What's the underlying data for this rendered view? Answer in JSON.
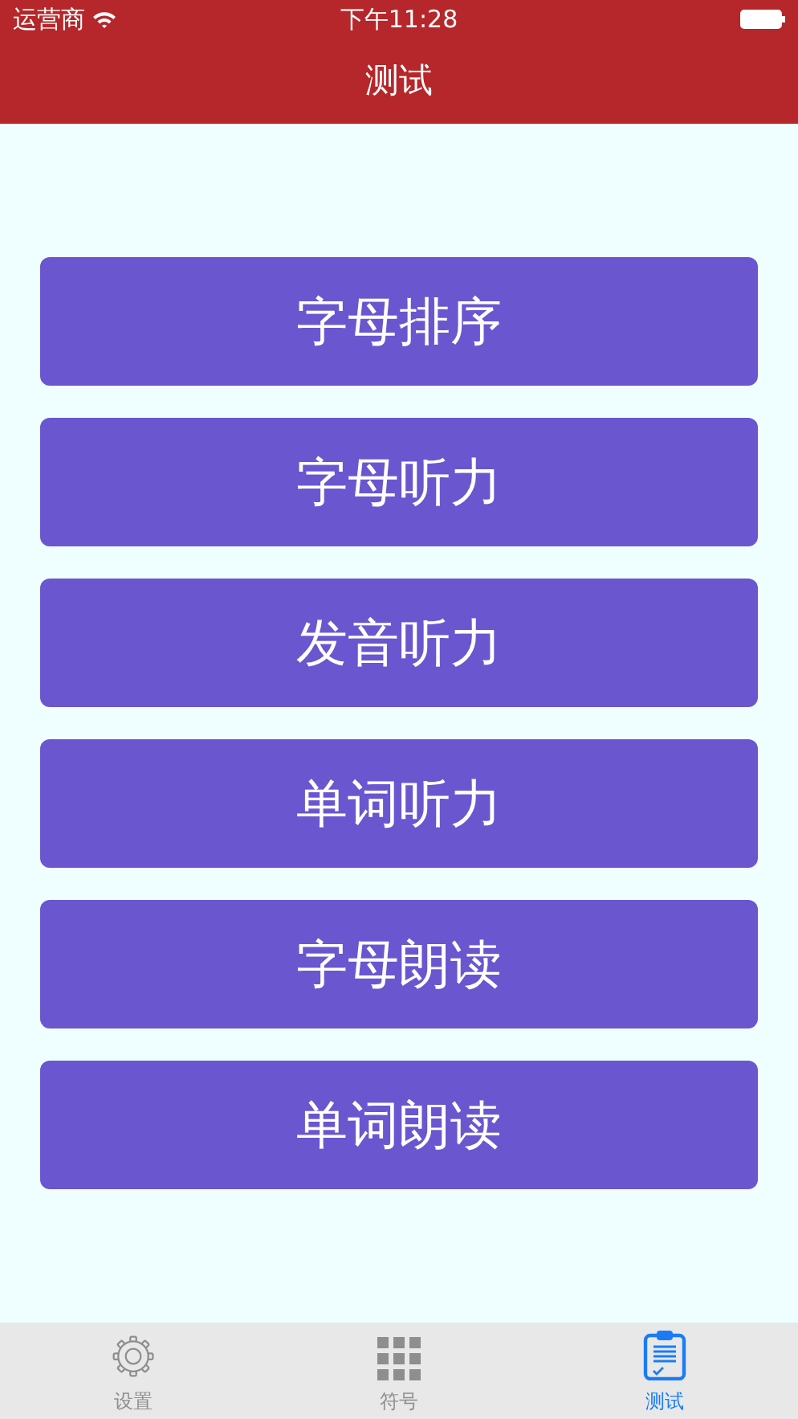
{
  "status_bar": {
    "carrier": "运营商",
    "time": "下午11:28"
  },
  "nav_bar": {
    "title": "测试"
  },
  "buttons": [
    "字母排序",
    "字母听力",
    "发音听力",
    "单词听力",
    "字母朗读",
    "单词朗读"
  ],
  "tab_bar": [
    {
      "kind": "gear",
      "label": "设置",
      "selected": false
    },
    {
      "kind": "grid",
      "label": "符号",
      "selected": false
    },
    {
      "kind": "clipboard",
      "label": "测试",
      "selected": true
    }
  ]
}
